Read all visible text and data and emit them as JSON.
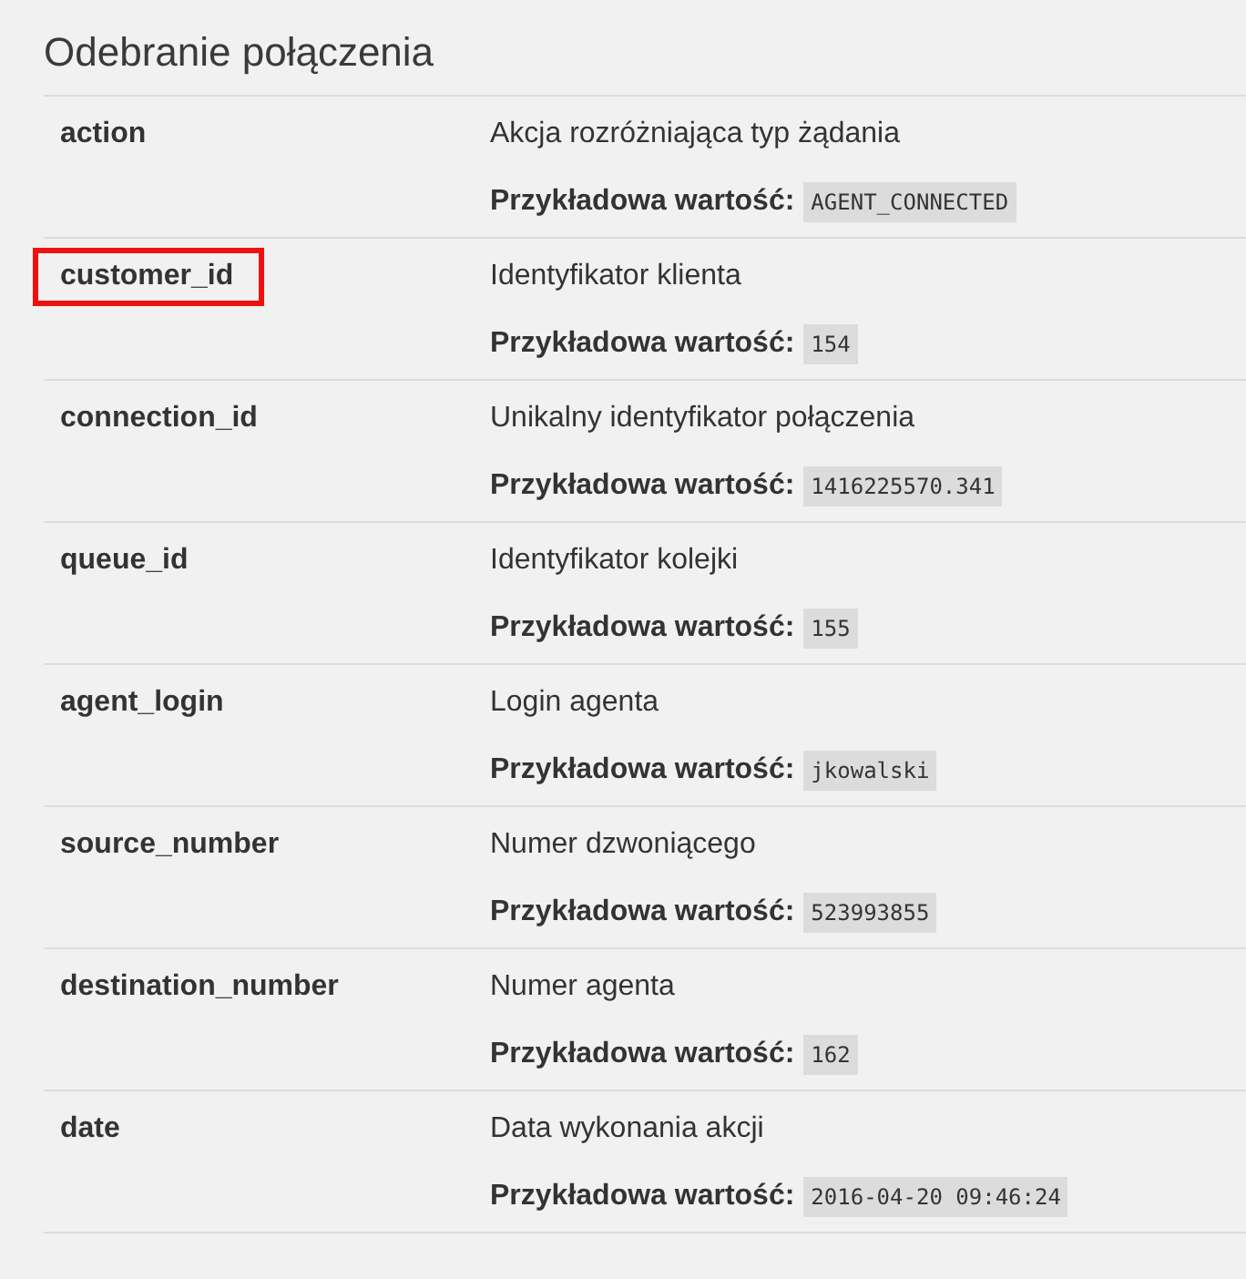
{
  "title": "Odebranie połączenia",
  "params": [
    {
      "name": "action",
      "highlighted": false,
      "description": "Akcja rozróżniająca typ żądania",
      "example_label": "Przykładowa wartość:",
      "example_value": "AGENT_CONNECTED"
    },
    {
      "name": "customer_id",
      "highlighted": true,
      "description": "Identyfikator klienta",
      "example_label": "Przykładowa wartość:",
      "example_value": "154"
    },
    {
      "name": "connection_id",
      "highlighted": false,
      "description": "Unikalny identyfikator połączenia",
      "example_label": "Przykładowa wartość:",
      "example_value": "1416225570.341"
    },
    {
      "name": "queue_id",
      "highlighted": false,
      "description": "Identyfikator kolejki",
      "example_label": "Przykładowa wartość:",
      "example_value": "155"
    },
    {
      "name": "agent_login",
      "highlighted": false,
      "description": "Login agenta",
      "example_label": "Przykładowa wartość:",
      "example_value": "jkowalski"
    },
    {
      "name": "source_number",
      "highlighted": false,
      "description": "Numer dzwoniącego",
      "example_label": "Przykładowa wartość:",
      "example_value": "523993855"
    },
    {
      "name": "destination_number",
      "highlighted": false,
      "description": "Numer agenta",
      "example_label": "Przykładowa wartość:",
      "example_value": "162"
    },
    {
      "name": "date",
      "highlighted": false,
      "description": "Data wykonania akcji",
      "example_label": "Przykładowa wartość:",
      "example_value": "2016-04-20 09:46:24"
    }
  ]
}
